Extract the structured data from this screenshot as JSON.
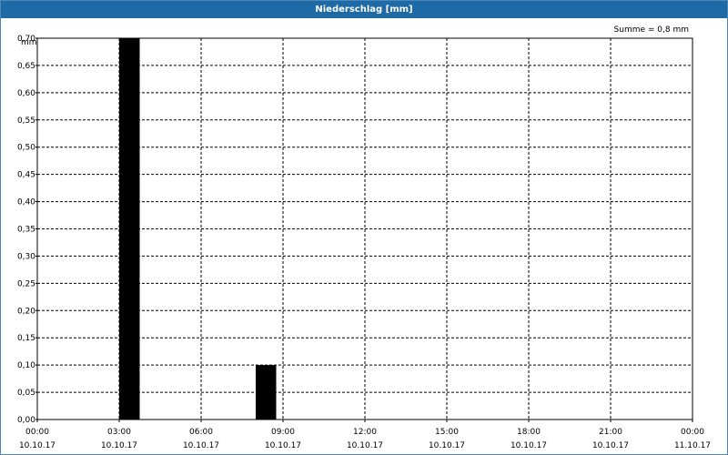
{
  "window": {
    "title": "Niederschlag [mm]"
  },
  "colors": {
    "titlebar": "#1e6aa6",
    "bars": "#000000",
    "grid": "#000000",
    "background": "#ffffff"
  },
  "chart_data": {
    "type": "bar",
    "title": "Niederschlag [mm]",
    "sum_label": "Summe = 0,8 mm",
    "ylabel": "mm",
    "xlabel": "",
    "ylim": [
      0,
      0.7
    ],
    "y_ticks": [
      "0,00",
      "0,05",
      "0,10",
      "0,15",
      "0,20",
      "0,25",
      "0,30",
      "0,35",
      "0,40",
      "0,45",
      "0,50",
      "0,55",
      "0,60",
      "0,65",
      "0,70"
    ],
    "x_ticks": [
      {
        "time": "00:00",
        "date": "10.10.17"
      },
      {
        "time": "03:00",
        "date": "10.10.17"
      },
      {
        "time": "06:00",
        "date": "10.10.17"
      },
      {
        "time": "09:00",
        "date": "10.10.17"
      },
      {
        "time": "12:00",
        "date": "10.10.17"
      },
      {
        "time": "15:00",
        "date": "10.10.17"
      },
      {
        "time": "18:00",
        "date": "10.10.17"
      },
      {
        "time": "21:00",
        "date": "10.10.17"
      },
      {
        "time": "00:00",
        "date": "11.10.17"
      }
    ],
    "grid": true,
    "series": [
      {
        "values": [
          {
            "start": "10.10.17 03:00",
            "end": "10.10.17 03:45",
            "value": 0.7
          },
          {
            "start": "10.10.17 08:00",
            "end": "10.10.17 08:45",
            "value": 0.1
          }
        ]
      }
    ]
  }
}
